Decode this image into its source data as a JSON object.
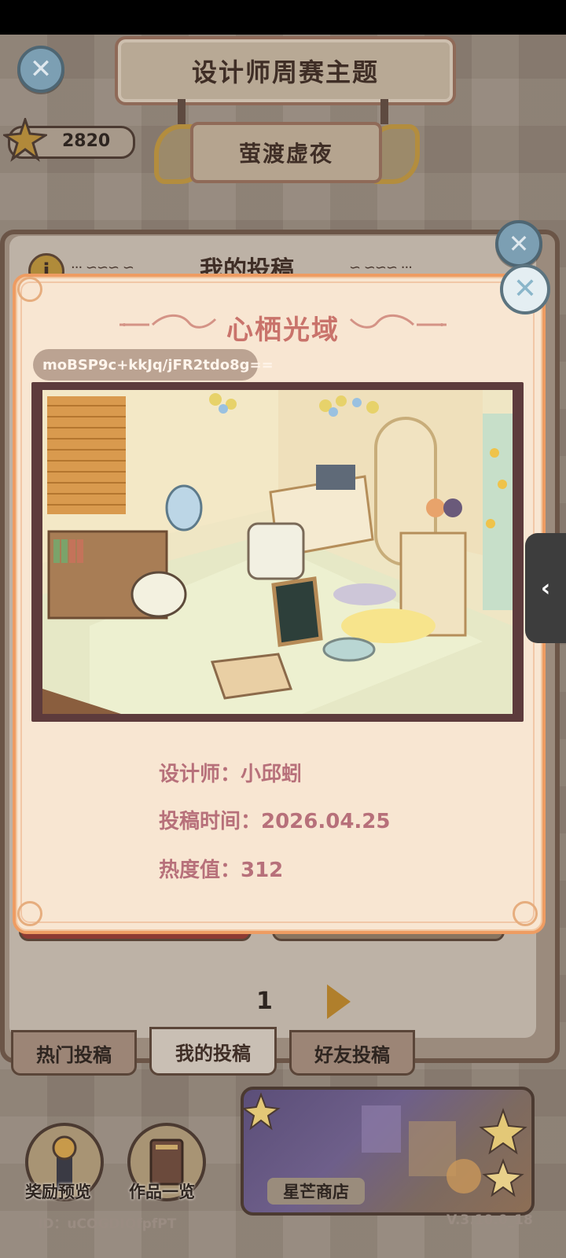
{
  "header": {
    "title": "设计师周赛主题",
    "theme_name": "萤渡虚夜",
    "stars": "2820"
  },
  "panel": {
    "title": "我的投稿",
    "page": "1"
  },
  "tabs": [
    "热门投稿",
    "我的投稿",
    "好友投稿"
  ],
  "bottom": {
    "reward_preview": "奖励预览",
    "works_list": "作品一览",
    "shop": "星芒商店",
    "user_id": "ID：uCOGDIQfpfPT",
    "version": "V.3.10.0_18"
  },
  "dialog": {
    "title": "心栖光域",
    "code": "moBSP9c+kkJq/jFR2tdo8g==",
    "designer": "设计师：小邱蚓",
    "submit_time": "投稿时间：2026.04.25",
    "heat": "热度值：312"
  },
  "colors": {
    "dialog_bg": "#f8e6d2",
    "dialog_border": "#ee9c62",
    "title_pink": "#c9736b",
    "meta_text": "#b7707a"
  }
}
